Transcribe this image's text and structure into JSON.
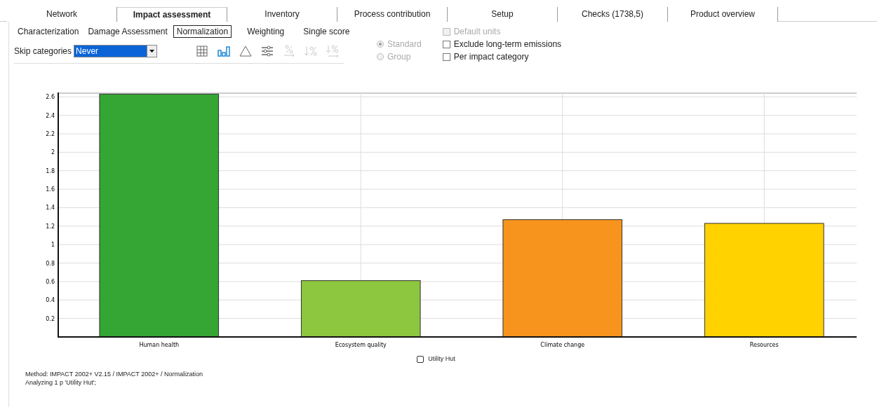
{
  "tabs": [
    {
      "label": "Network",
      "selected": false
    },
    {
      "label": "Impact assessment",
      "selected": true
    },
    {
      "label": "Inventory",
      "selected": false
    },
    {
      "label": "Process contribution",
      "selected": false
    },
    {
      "label": "Setup",
      "selected": false
    },
    {
      "label": "Checks (1738,5)",
      "selected": false
    },
    {
      "label": "Product overview",
      "selected": false
    }
  ],
  "subtabs": [
    {
      "label": "Characterization",
      "selected": false
    },
    {
      "label": "Damage Assessment",
      "selected": false
    },
    {
      "label": "Normalization",
      "selected": true
    },
    {
      "label": "Weighting",
      "selected": false
    },
    {
      "label": "Single score",
      "selected": false
    }
  ],
  "skip_categories": {
    "label": "Skip categories",
    "value": "Never"
  },
  "toolbar": [
    {
      "kind": "table",
      "selected": false,
      "disabled": false
    },
    {
      "kind": "bars",
      "selected": true,
      "disabled": false
    },
    {
      "kind": "triangle",
      "selected": false,
      "disabled": false
    },
    {
      "kind": "sliders",
      "selected": false,
      "disabled": false
    },
    {
      "kind": "percent",
      "selected": false,
      "disabled": true
    },
    {
      "kind": "sortpercent",
      "selected": false,
      "disabled": true
    },
    {
      "kind": "sortpercentarrow",
      "selected": false,
      "disabled": true
    }
  ],
  "radios": [
    {
      "label": "Standard",
      "selected": true,
      "disabled": true
    },
    {
      "label": "Group",
      "selected": false,
      "disabled": true
    }
  ],
  "checkboxes": [
    {
      "label": "Default units",
      "checked": false,
      "disabled": true
    },
    {
      "label": "Exclude long-term emissions",
      "checked": false,
      "disabled": false
    },
    {
      "label": "Per impact category",
      "checked": false,
      "disabled": false
    }
  ],
  "chart_data": {
    "type": "bar",
    "categories": [
      "Human health",
      "Ecosystem quality",
      "Climate change",
      "Resources"
    ],
    "series": [
      {
        "name": "Utility Hut",
        "values": [
          2.63,
          0.61,
          1.27,
          1.23
        ]
      }
    ],
    "grid": true,
    "ylim": [
      0,
      2.64
    ],
    "yticks": [
      0.2,
      0.4,
      0.6,
      0.8,
      1,
      1.2,
      1.4,
      1.6,
      1.8,
      2,
      2.2,
      2.4,
      2.6
    ]
  },
  "footer": [
    "Method: IMPACT 2002+ V2.15 / IMPACT 2002+ / Normalization",
    "Analyzing 1 p 'Utility Hut';"
  ]
}
